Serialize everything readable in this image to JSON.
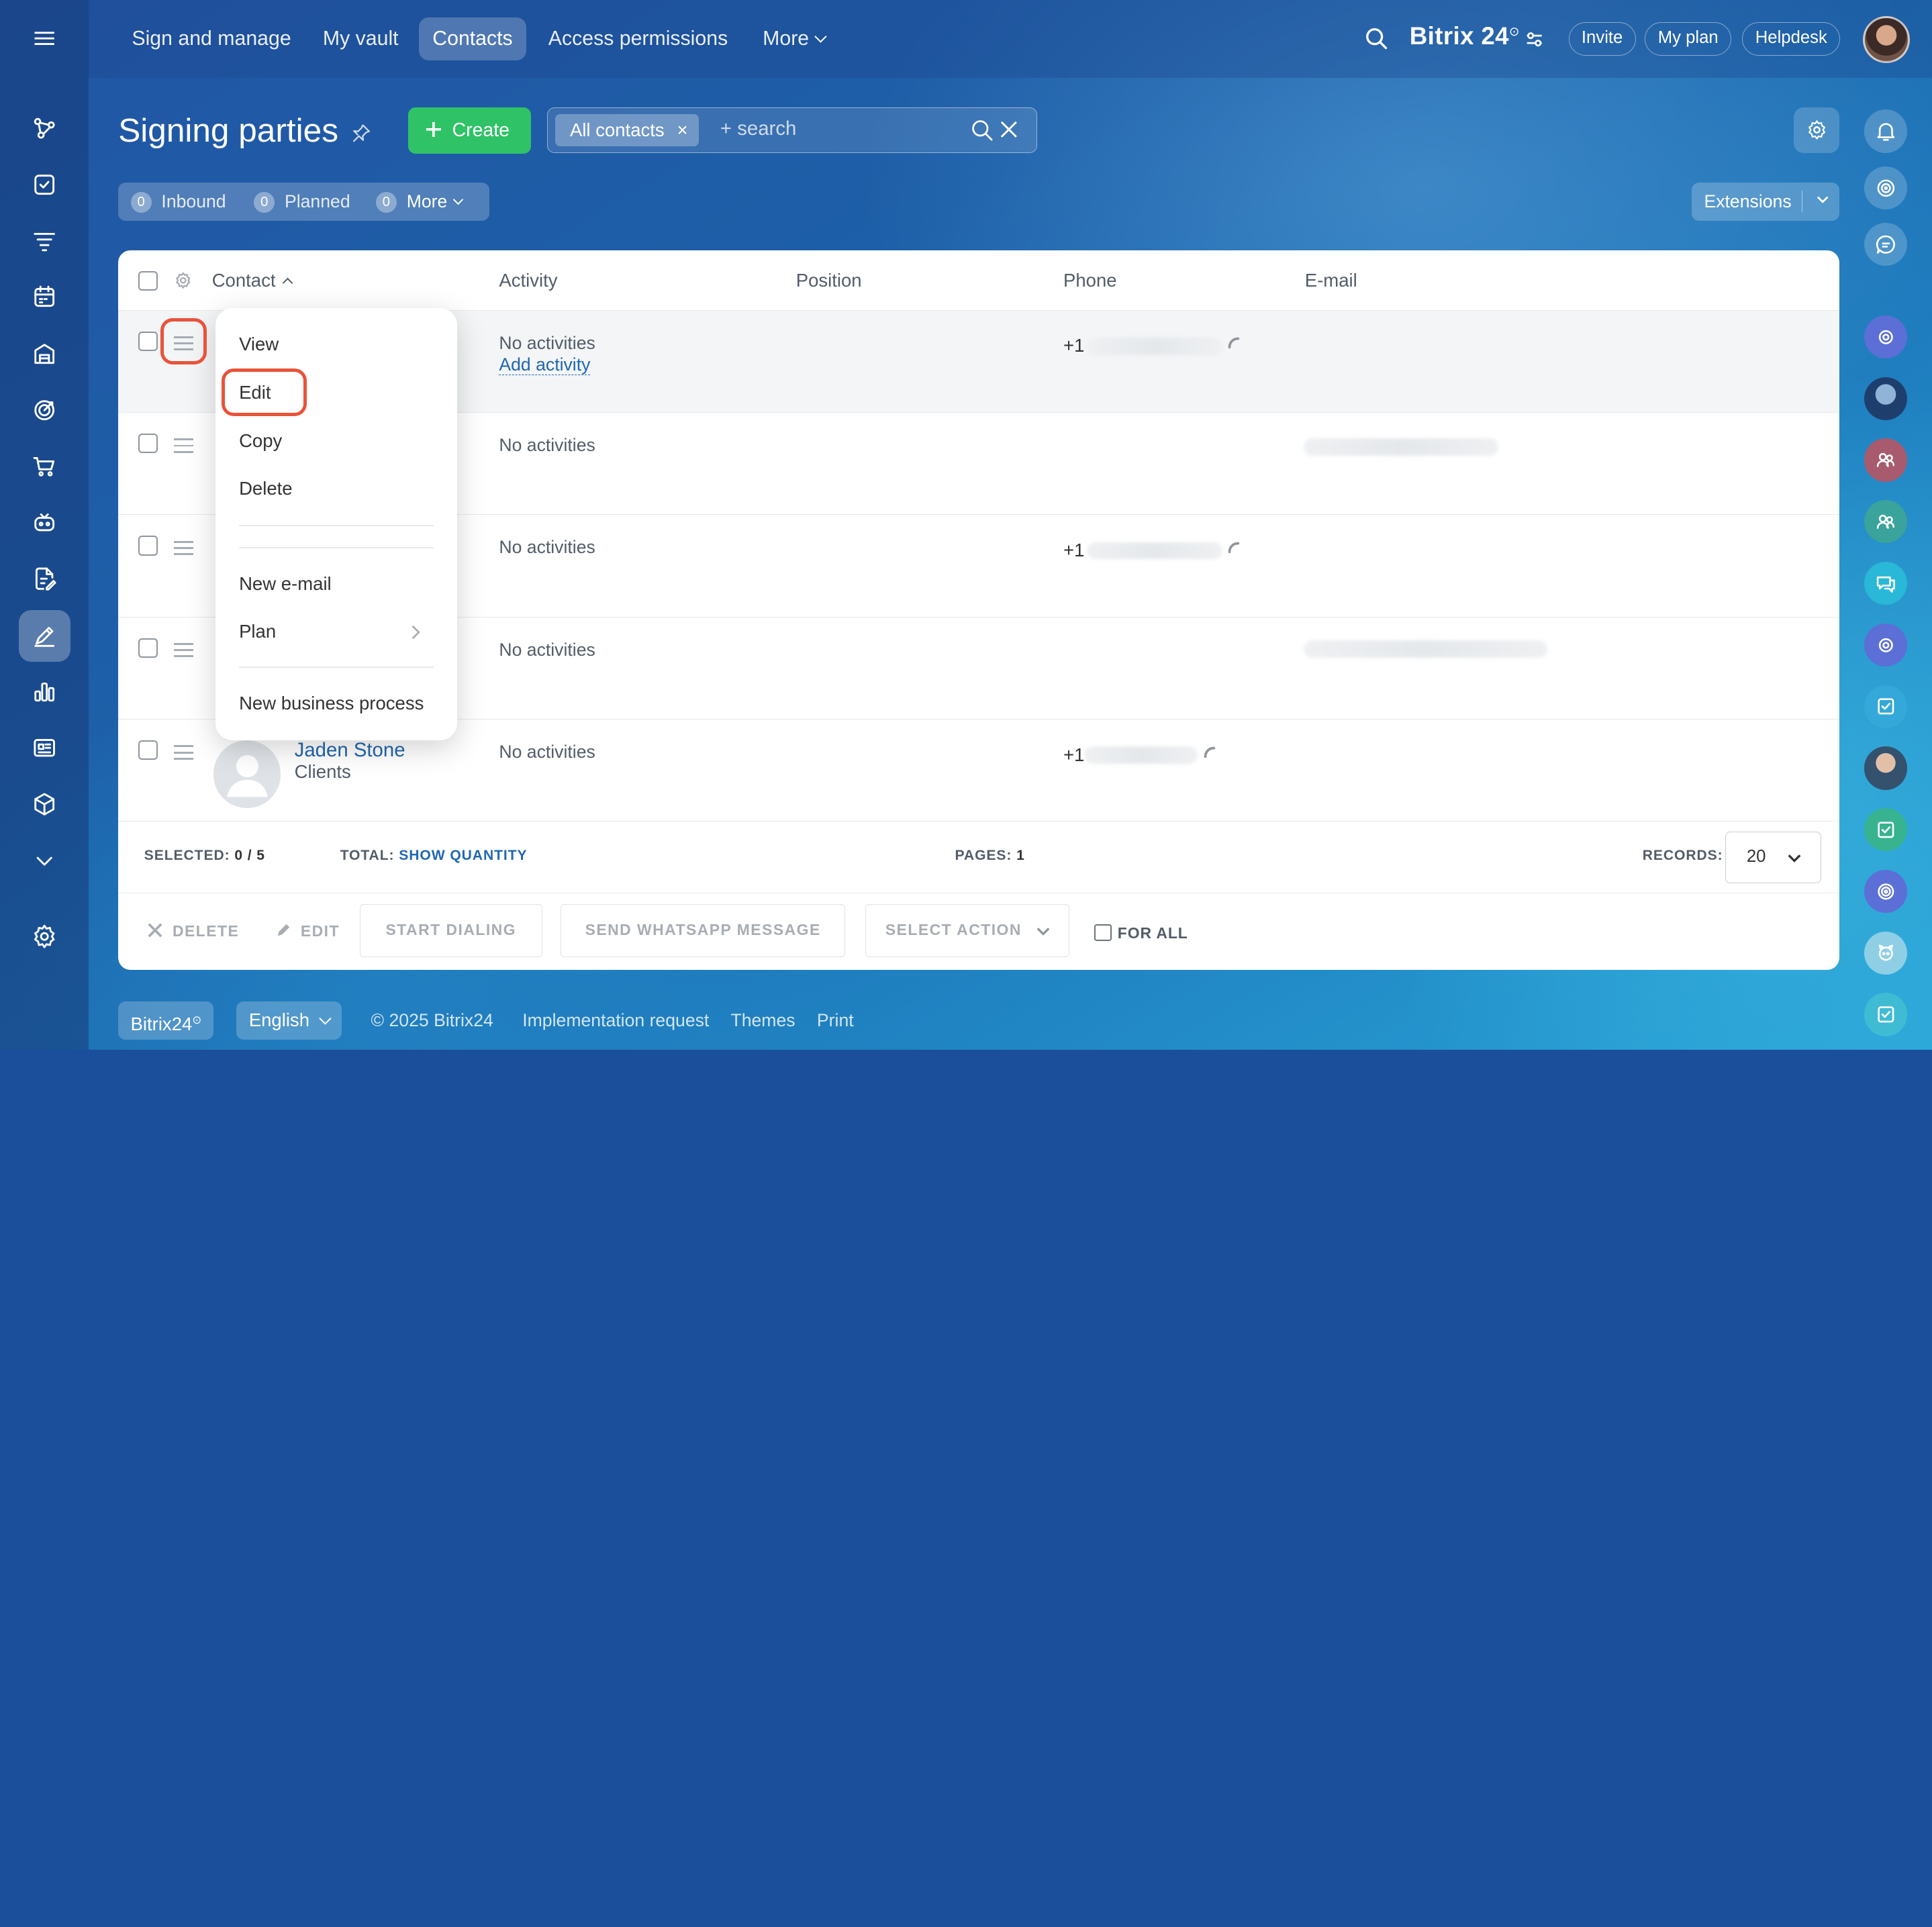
{
  "topnav": {
    "items": [
      {
        "label": "Sign and manage",
        "active": false
      },
      {
        "label": "My vault",
        "active": false
      },
      {
        "label": "Contacts",
        "active": true
      },
      {
        "label": "Access permissions",
        "active": false
      },
      {
        "label": "More",
        "active": false
      }
    ],
    "brand": "Bitrix 24",
    "brand_mark": "⊙",
    "invite": "Invite",
    "my_plan": "My plan",
    "helpdesk": "Helpdesk"
  },
  "page": {
    "title": "Signing parties",
    "create_label": "Create",
    "filter_tag": "All contacts",
    "filter_tag_clear": "×",
    "search_placeholder": "+ search"
  },
  "counters": {
    "inbound_count": "0",
    "inbound_label": "Inbound",
    "planned_count": "0",
    "planned_label": "Planned",
    "more_count": "0",
    "more_label": "More"
  },
  "extensions_label": "Extensions",
  "grid": {
    "columns": [
      "Contact",
      "Activity",
      "Position",
      "Phone",
      "E-mail"
    ],
    "rows": [
      {
        "activity": "No activities",
        "activity_link": "Add activity",
        "phone_prefix": "+1"
      },
      {
        "activity": "No activities",
        "phone_prefix": ""
      },
      {
        "activity": "No activities",
        "phone_prefix": "+1"
      },
      {
        "activity": "No activities",
        "phone_prefix": ""
      },
      {
        "activity": "No activities",
        "phone_prefix": "+1",
        "name": "Jaden Stone",
        "type": "Clients"
      }
    ]
  },
  "footer": {
    "selected_label": "SELECTED:",
    "selected_value": "0 / 5",
    "total_label": "TOTAL:",
    "total_link": "SHOW QUANTITY",
    "pages_label": "PAGES:",
    "pages_value": "1",
    "records_label": "RECORDS:",
    "records_value": "20"
  },
  "actions": {
    "delete": "DELETE",
    "edit": "EDIT",
    "start_dialing": "START DIALING",
    "send_whatsapp": "SEND WHATSAPP MESSAGE",
    "select_action": "SELECT ACTION",
    "for_all": "FOR ALL"
  },
  "row_menu": {
    "items": [
      "View",
      "Edit",
      "Copy",
      "Delete",
      "New e-mail",
      "Plan",
      "New business process"
    ],
    "highlighted": "Edit"
  },
  "bottom": {
    "brand": "Bitrix24",
    "brand_mark": "⊙",
    "language": "English",
    "copyright": "© 2025 Bitrix24",
    "implementation": "Implementation request",
    "themes": "Themes",
    "print": "Print"
  },
  "colors": {
    "accent_green": "#2fc266",
    "link_blue": "#2067b0",
    "highlight_red": "#e8533a"
  }
}
